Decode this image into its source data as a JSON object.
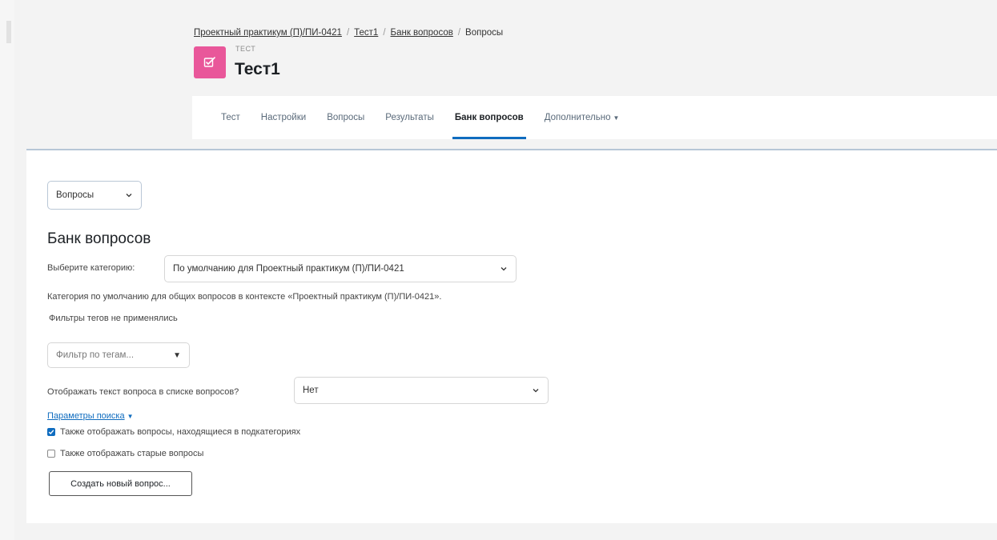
{
  "breadcrumb": {
    "items": [
      "Проектный практикум (П)/ПИ-0421",
      "Тест1",
      "Банк вопросов",
      "Вопросы"
    ]
  },
  "header": {
    "activity_type": "ТЕСТ",
    "title": "Тест1",
    "icon": "quiz-icon",
    "icon_color": "#e9579a"
  },
  "tabs": [
    {
      "label": "Тест"
    },
    {
      "label": "Настройки"
    },
    {
      "label": "Вопросы"
    },
    {
      "label": "Результаты"
    },
    {
      "label": "Банк вопросов",
      "active": true
    },
    {
      "label": "Дополнительно",
      "dropdown": true
    }
  ],
  "main": {
    "nav_select": "Вопросы",
    "heading": "Банк вопросов",
    "category_label": "Выберите категорию:",
    "category_value": "По умолчанию для Проектный практикум (П)/ПИ-0421",
    "category_description": "Категория по умолчанию для общих вопросов в контексте «Проектный практикум (П)/ПИ-0421».",
    "filter_status": "Фильтры тегов не применялись",
    "tag_filter_placeholder": "Фильтр по тегам...",
    "show_text_label": "Отображать текст вопроса в списке вопросов?",
    "show_text_value": "Нет",
    "search_options_label": "Параметры поиска",
    "checkbox_subcategories": {
      "label": "Также отображать вопросы, находящиеся в подкатегориях",
      "checked": true
    },
    "checkbox_old": {
      "label": "Также отображать старые вопросы",
      "checked": false
    },
    "create_button": "Создать новый вопрос..."
  },
  "colors": {
    "accent": "#0f6cbf",
    "quiz_icon": "#e9579a"
  }
}
